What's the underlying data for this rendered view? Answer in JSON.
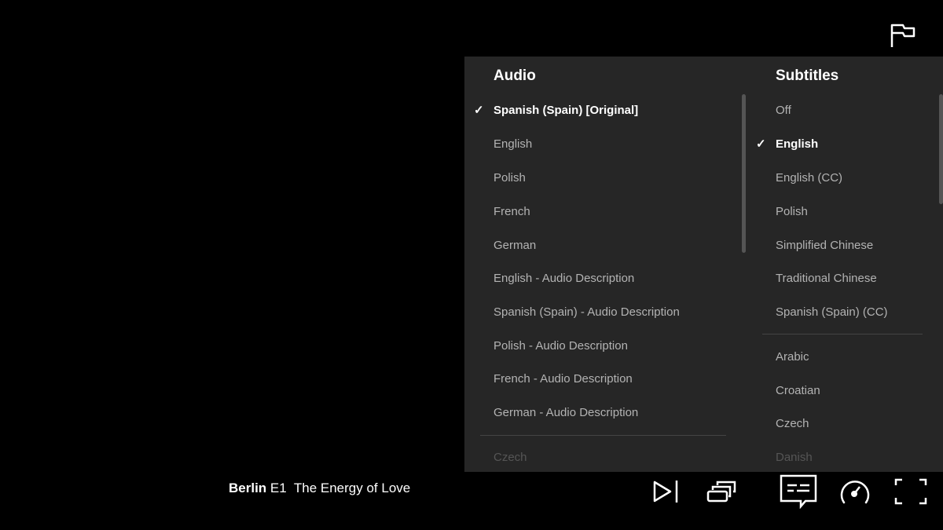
{
  "audio": {
    "heading": "Audio",
    "items": [
      {
        "label": "Spanish (Spain) [Original]",
        "selected": true
      },
      {
        "label": "English"
      },
      {
        "label": "Polish"
      },
      {
        "label": "French"
      },
      {
        "label": "German"
      },
      {
        "label": "English - Audio Description"
      },
      {
        "label": "Spanish (Spain) - Audio Description"
      },
      {
        "label": "Polish - Audio Description"
      },
      {
        "label": "French - Audio Description"
      },
      {
        "label": "German - Audio Description"
      }
    ],
    "more": [
      {
        "label": "Czech"
      }
    ]
  },
  "subtitles": {
    "heading": "Subtitles",
    "items": [
      {
        "label": "Off"
      },
      {
        "label": "English",
        "selected": true
      },
      {
        "label": "English (CC)"
      },
      {
        "label": "Polish"
      },
      {
        "label": "Simplified Chinese"
      },
      {
        "label": "Traditional Chinese"
      },
      {
        "label": "Spanish (Spain) (CC)"
      }
    ],
    "more": [
      {
        "label": "Arabic"
      },
      {
        "label": "Croatian"
      },
      {
        "label": "Czech"
      },
      {
        "label": "Danish"
      }
    ]
  },
  "episode": {
    "show": "Berlin",
    "episode": "E1",
    "title": "The Energy of Love"
  },
  "icons": [
    "flag-icon",
    "next-episode-icon",
    "episodes-icon",
    "subtitles-icon",
    "speed-icon",
    "fullscreen-icon"
  ],
  "check_glyph": "✓"
}
